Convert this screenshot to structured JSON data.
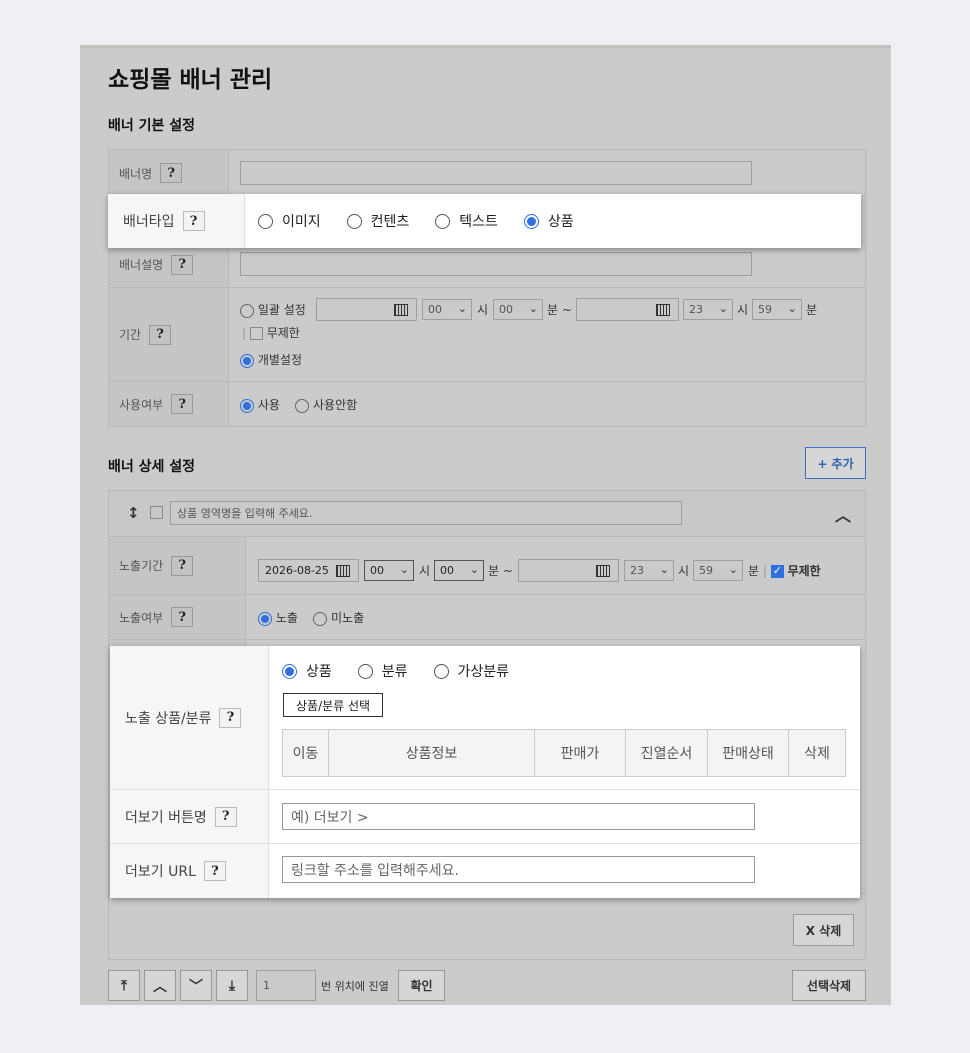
{
  "page": {
    "title": "쇼핑몰 배너 관리"
  },
  "basic": {
    "title": "배너 기본 설정",
    "name_label": "배너명",
    "type_label": "배너타입",
    "type_options": [
      "이미지",
      "컨텐츠",
      "텍스트",
      "상품"
    ],
    "type_selected": "상품",
    "desc_label": "배너설명",
    "period_label": "기간",
    "period_bulk": "일괄 설정",
    "period_start_hour": "00",
    "period_start_min": "00",
    "period_end_hour": "23",
    "period_end_min": "59",
    "hour_unit": "시",
    "min_unit": "분",
    "min_unit_tilde": "분 ~",
    "unlimited": "무제한",
    "individual": "개별설정",
    "use_label": "사용여부",
    "use_on": "사용",
    "use_off": "사용안함"
  },
  "detail": {
    "title": "배너 상세 설정",
    "add_button": "+ 추가",
    "area_placeholder": "상품 영역명을 입력해 주세요.",
    "exposure_period_label": "노출기간",
    "start_date": "2026-08-25",
    "start_hour": "00",
    "start_min": "00",
    "end_hour": "23",
    "end_min": "59",
    "unlimited": "무제한",
    "exposure_label": "노출여부",
    "expose_on": "노출",
    "expose_off": "미노출",
    "product_label": "노출 상품/분류",
    "product_options": [
      "상품",
      "분류",
      "가상분류"
    ],
    "product_select_button": "상품/분류 선택",
    "columns": [
      "이동",
      "상품정보",
      "판매가",
      "진열순서",
      "판매상태",
      "삭제"
    ],
    "more_button_label": "더보기 버튼명",
    "more_button_placeholder": "예) 더보기 >",
    "more_url_label": "더보기 URL",
    "more_url_placeholder": "링크할 주소를 입력해주세요.",
    "delete_button": "X 삭제"
  },
  "footer": {
    "position_value": "1",
    "position_text": "번 위치에 진열",
    "confirm": "확인",
    "delete_selected": "선택삭제"
  },
  "colors": {
    "accent": "#2f6fe0",
    "dim_bg": "#cbcbcb"
  }
}
